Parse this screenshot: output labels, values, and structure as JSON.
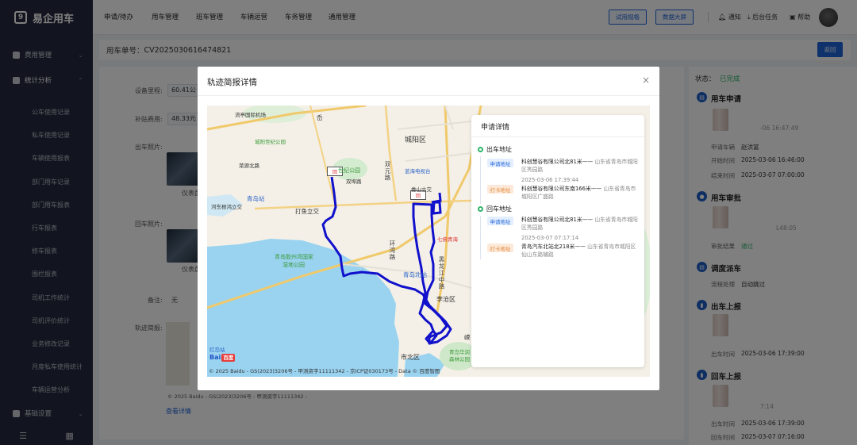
{
  "app": {
    "logo_text": "易企用车",
    "logo_mark": "9"
  },
  "sidebar": {
    "groups": [
      {
        "label": "费用管理",
        "icon": "money-icon"
      },
      {
        "label": "统计分析",
        "icon": "chart-icon"
      },
      {
        "label": "基础设置",
        "icon": "settings-icon"
      }
    ],
    "items": [
      "公车使用记录",
      "私车使用记录",
      "车辆使用报表",
      "部门用车记录",
      "部门用车报表",
      "行车报表",
      "修车报表",
      "围栏报表",
      "司机工作统计",
      "司机评价统计",
      "业务修改记录",
      "月度私车使用统计",
      "车辆运营分析"
    ],
    "footer_icons": [
      "menu-collapse-icon",
      "grid-icon"
    ]
  },
  "topnav": {
    "items": [
      "申请/待办",
      "用车管理",
      "班车管理",
      "车辆运营",
      "车务管理",
      "通用管理"
    ],
    "buttons": [
      "试用规格",
      "数据大屏"
    ],
    "right": {
      "notify": "通知",
      "tasks": "后台任务",
      "help": "帮助"
    }
  },
  "order": {
    "label": "用车单号：",
    "number": "CV2025030616474821",
    "back": "返回"
  },
  "form": {
    "device_mileage_label": "设备里程:",
    "device_mileage": "60.41公",
    "subsidy_label": "补贴费用:",
    "subsidy": "48.33元",
    "out_photo_label": "出车照片:",
    "out_photo_caption": "仪表盘",
    "back_photo_label": "回车照片:",
    "back_photo_caption": "仪表盘",
    "remark_label": "备注:",
    "remark": "无",
    "track_label": "轨迹简报:",
    "map_copyright": "© 2025 Baidu - GS(2023)3206号 - 甲测资字11111342 -",
    "view_detail": "查看详情"
  },
  "right_panel": {
    "status_label": "状态：",
    "status": "已完成",
    "sections": [
      {
        "title": "用车申请",
        "ts_suffix": "-06 16:47:49",
        "rows": [
          [
            "申请车辆",
            "赵洪富"
          ],
          [
            "开始时间",
            "2025-03-06 16:46:00"
          ],
          [
            "结束时间",
            "2025-03-07 07:00:00"
          ]
        ]
      },
      {
        "title": "用车审批",
        "ts_suffix": "L48:05",
        "rows": [
          [
            "审批结果",
            "通过"
          ]
        ]
      },
      {
        "title": "调度派车",
        "rows": [
          [
            "流程处理",
            "自动跳过"
          ]
        ]
      },
      {
        "title": "出车上报",
        "rows": [
          [
            "出车时间",
            "2025-03-06 17:39:00"
          ]
        ]
      },
      {
        "title": "回车上报",
        "ts_suffix": "7:14",
        "rows": [
          [
            "出车时间",
            "2025-03-06 17:39:00"
          ],
          [
            "回车时间",
            "2025-03-07 07:16:00"
          ]
        ]
      }
    ]
  },
  "modal": {
    "title": "轨迹简报详情",
    "close": "×",
    "map": {
      "labels": [
        "城阳区",
        "双元路",
        "青岛站",
        "打鱼立交",
        "岙",
        "娄山立交",
        "蓝海电视台",
        "世纪公园",
        "环湾路",
        "黑龙江中路",
        "李沧区",
        "青岛北站",
        "市北区",
        "嵘",
        "青岛华润",
        "森林公园",
        "红岛站",
        "流亭国际机场",
        "青岛胶州湾国家",
        "湿地公园",
        "七佛青海",
        "城阳世纪公园",
        "菜源北路",
        "河东根鸿立交",
        "双埠路"
      ],
      "pin_labels": [
        "回",
        "回"
      ],
      "logo": "Bai",
      "logo_badge": "百度",
      "copyright": "© 2025 Baidu - GS(2023)3206号 - 甲测资字11111342 - 京ICP证030173号 - Data © 百度智图"
    },
    "detail": {
      "title": "申请详情",
      "out": {
        "heading": "出车地址",
        "apply_tag": "申请地址",
        "apply_addr": "科创慧谷有限公司北81米——",
        "apply_region": "山东省青岛市城阳区秀园路",
        "punch_tag": "打卡地址",
        "punch_time": "2025-03-06 17:39:44",
        "punch_addr": "科创慧谷有限公司东南166米——",
        "punch_region": "山东省青岛市城阳区广盛路"
      },
      "back": {
        "heading": "回车地址",
        "apply_tag": "申请地址",
        "apply_addr": "科创慧谷有限公司北81米——",
        "apply_region": "山东省青岛市城阳区秀园路",
        "punch_tag": "打卡地址",
        "punch_time": "2025-03-07 07:17:14",
        "punch_addr": "青岛汽车北站北218米——",
        "punch_region": "山东省青岛市城阳区仙山东路辅路"
      }
    }
  },
  "colors": {
    "primary": "#1f64d9",
    "sidebar": "#242b3f",
    "route": "#1111cc",
    "success": "#2fb56b",
    "water": "#9ad3f0"
  }
}
